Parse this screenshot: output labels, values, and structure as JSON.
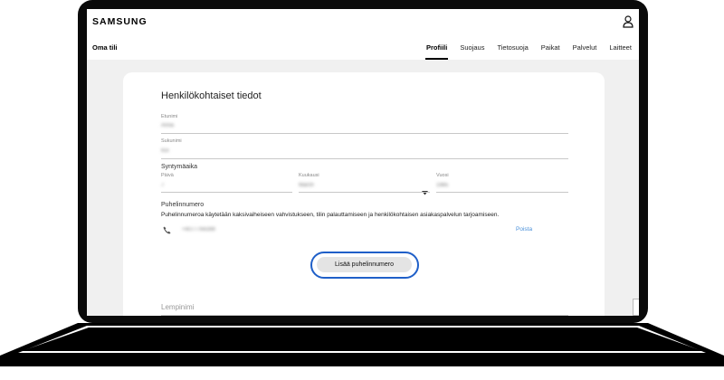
{
  "header": {
    "logo_text": "SAMSUNG",
    "account_title": "Oma tili"
  },
  "tabs": [
    {
      "label": "Profiili",
      "active": true
    },
    {
      "label": "Suojaus",
      "active": false
    },
    {
      "label": "Tietosuoja",
      "active": false
    },
    {
      "label": "Paikat",
      "active": false
    },
    {
      "label": "Palvelut",
      "active": false
    },
    {
      "label": "Laitteet",
      "active": false
    }
  ],
  "profile": {
    "section_title": "Henkilökohtaiset tiedot",
    "first_name": {
      "label": "Etunimi",
      "value": "Anna"
    },
    "last_name": {
      "label": "Sukunimi",
      "value": "Kiri"
    },
    "birthdate": {
      "label": "Syntymäaika",
      "day": {
        "label": "Päivä",
        "value": "7"
      },
      "month": {
        "label": "Kuukausi",
        "value": "March"
      },
      "year": {
        "label": "Vuosi",
        "value": "1985"
      }
    },
    "phone": {
      "label": "Puhelinnumero",
      "help": "Puhelinnumeroa käytetään kaksivaiheiseen vahvistukseen, tilin palauttamiseen ja henkilökohtaisen asiakaspalvelun tarjoamiseen.",
      "number": "+4077764399",
      "remove_label": "Poista",
      "add_label": "Lisää puhelinnumero"
    },
    "nickname": {
      "label": "Lempinimi"
    }
  },
  "colors": {
    "highlight_ring": "#1f5fc8",
    "link": "#4a90d9",
    "frame": "#0a0a0a"
  }
}
